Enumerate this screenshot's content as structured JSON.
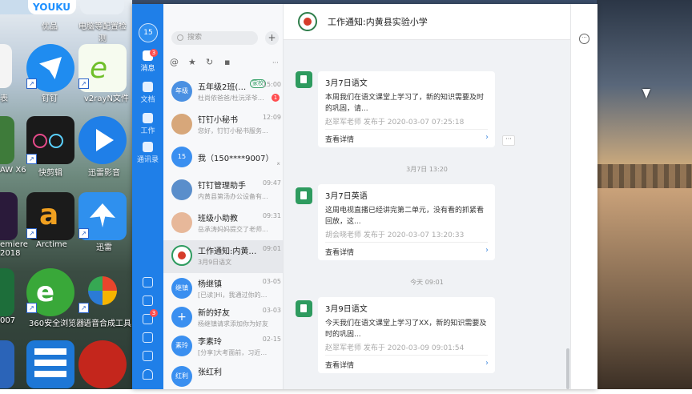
{
  "desktop": {
    "icons": [
      {
        "label": "优品",
        "color": "#c9dced"
      },
      {
        "label": "YOUKU",
        "color": "#ffffff"
      },
      {
        "label": "电脑等配置检测",
        "color": "#e8eef4"
      },
      {
        "label": "表",
        "color": "#f4f4f4"
      },
      {
        "label": "钉钉",
        "color": "#1f8cf0"
      },
      {
        "label": "v2rayN文件",
        "color": "#f6fbef"
      },
      {
        "label": "AW X6",
        "color": "#3e7b3a"
      },
      {
        "label": "快剪辑",
        "color": "#1a1a1a"
      },
      {
        "label": "迅雷影音",
        "color": "#1f7fe8"
      },
      {
        "label": "emiere 2018",
        "color": "#2a1a3a"
      },
      {
        "label": "Arctime",
        "color": "#1b1b1b"
      },
      {
        "label": "迅雷",
        "color": "#2f90ee"
      },
      {
        "label": "007",
        "color": "#1d6e3a"
      },
      {
        "label": "360安全浏览器",
        "color": "#39a839"
      },
      {
        "label": "语音合成工具",
        "color": "#f5f5f5"
      },
      {
        "label": "",
        "color": "#2b64b8"
      },
      {
        "label": "",
        "color": "#1d77d6"
      },
      {
        "label": "",
        "color": "#c4261c"
      }
    ]
  },
  "window": {
    "controls": [
      "−",
      "☐",
      "✕"
    ]
  },
  "nav": {
    "avatar": "15",
    "items": [
      {
        "label": "消息",
        "badge": "3"
      },
      {
        "label": "文档",
        "badge": ""
      },
      {
        "label": "工作",
        "badge": ""
      },
      {
        "label": "通讯录",
        "badge": ""
      }
    ],
    "bottom_badge": "3"
  },
  "list": {
    "search_placeholder": "搜索",
    "add_label": "+",
    "filters": [
      "@",
      "★",
      "↻",
      "▪",
      "···"
    ],
    "conversations": [
      {
        "avatar": "年级",
        "avatar_color": "#4a90e2",
        "name": "五年级2班(錢...",
        "tag": "家校",
        "time": "15:00",
        "preview": "杜尚依爸爸/杜沅泽爷爷(家...",
        "badge": "1"
      },
      {
        "avatar": "",
        "avatar_color": "#d7a77a",
        "name": "钉钉小秘书",
        "tag": "",
        "time": "12:09",
        "preview": "您好，钉钉小秘书服务...",
        "badge": ""
      },
      {
        "avatar": "15",
        "avatar_color": "#3a8ff0",
        "name": "我（150****9007）",
        "tag": "",
        "time": "",
        "preview": "",
        "badge": ""
      },
      {
        "avatar": "",
        "avatar_color": "#5a8ecb",
        "name": "钉钉管理助手",
        "tag": "",
        "time": "09:47",
        "preview": "内黄县第汤办公设备有...",
        "badge": ""
      },
      {
        "avatar": "",
        "avatar_color": "#e7b89a",
        "name": "班级小助教",
        "tag": "",
        "time": "09:31",
        "preview": "岳承涛妈妈提交了老师...",
        "badge": ""
      },
      {
        "avatar": "",
        "avatar_color": "#2e9b5f",
        "name": "工作通知:内黄县实...",
        "tag": "",
        "time": "09:01",
        "preview": "3月9日语文",
        "badge": ""
      },
      {
        "avatar": "继镇",
        "avatar_color": "#3a8ff0",
        "name": "杨继镇",
        "tag": "",
        "time": "03-05",
        "preview": "[已读]Hi，我通过你的好...",
        "badge": ""
      },
      {
        "avatar": "+",
        "avatar_color": "#3a8ff0",
        "name": "新的好友",
        "tag": "",
        "time": "03-03",
        "preview": "杨继镇请求添加你为好友",
        "badge": ""
      },
      {
        "avatar": "素玲",
        "avatar_color": "#3a8ff0",
        "name": "李素玲",
        "tag": "",
        "time": "02-15",
        "preview": "[分享]大考面前，习近平...",
        "badge": ""
      },
      {
        "avatar": "红利",
        "avatar_color": "#3a8ff0",
        "name": "张红利",
        "tag": "",
        "time": "",
        "preview": "",
        "badge": ""
      }
    ]
  },
  "chat": {
    "title": "工作通知:内黄县实验小学",
    "more_label": "···",
    "messages": [
      {
        "title": "3月7日语文",
        "body": "本周我们在语文课堂上学习了，新的知识需要及时的巩固，请...",
        "meta": "赵翠军老师 发布于 2020-03-07 07:25:18",
        "link": "查看详情",
        "arrow": "›"
      },
      {
        "title": "3月7日英语",
        "body": "这周电视直播已经讲完第二单元，没有看的抓紧看回放，这...",
        "meta": "胡会晓老师 发布于 2020-03-07 13:20:33",
        "link": "查看详情",
        "arrow": "›"
      },
      {
        "title": "3月9日语文",
        "body": "今天我们在语文课堂上学习了XX，新的知识需要及时的巩固...",
        "meta": "赵翠军老师 发布于 2020-03-09 09:01:54",
        "link": "查看详情",
        "arrow": "›"
      }
    ],
    "timestamps": [
      "3月7日 13:20",
      "今天 09:01"
    ],
    "dots": "···"
  }
}
